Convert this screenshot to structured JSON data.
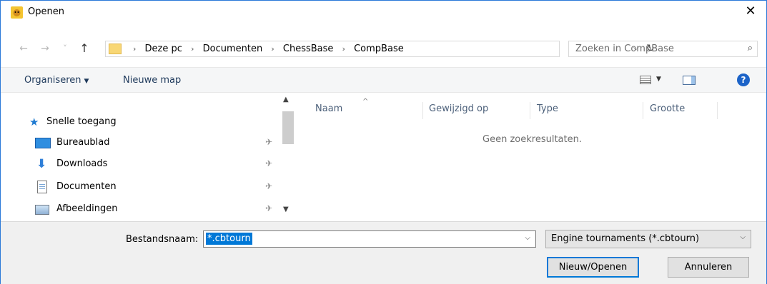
{
  "window": {
    "title": "Openen",
    "close_symbol": "✕"
  },
  "address": {
    "back_symbol": "←",
    "forward_symbol": "→",
    "recent_symbol": "˅",
    "up_symbol": "↑",
    "breadcrumbs": [
      "Deze pc",
      "Documenten",
      "ChessBase",
      "CompBase"
    ],
    "separator": "›",
    "dropdown_symbol": "⌵",
    "refresh_symbol": "↻"
  },
  "search": {
    "placeholder": "Zoeken in CompBase",
    "icon_symbol": "⌕"
  },
  "toolbar": {
    "organize_label": "Organiseren",
    "organize_caret": "▼",
    "new_folder_label": "Nieuwe map",
    "view_caret": "▼",
    "help_symbol": "?"
  },
  "navpane": {
    "quick_access": "Snelle toegang",
    "items": [
      {
        "label": "Bureaublad",
        "icon": "desktop-icon",
        "pinned": true
      },
      {
        "label": "Downloads",
        "icon": "download-icon",
        "pinned": true
      },
      {
        "label": "Documenten",
        "icon": "document-icon",
        "pinned": true
      },
      {
        "label": "Afbeeldingen",
        "icon": "pictures-icon",
        "pinned": true
      }
    ],
    "pin_symbol": "✈",
    "scroll_up": "▲",
    "scroll_down": "▼"
  },
  "filelist": {
    "columns": [
      "Naam",
      "Gewijzigd op",
      "Type",
      "Grootte"
    ],
    "sort_indicator": "^",
    "empty_message": "Geen zoekresultaten."
  },
  "bottom": {
    "filename_label": "Bestandsnaam:",
    "filename_value": "*.cbtourn",
    "combo_caret": "⌵",
    "filter_value": "Engine tournaments (*.cbtourn)",
    "open_button": "Nieuw/Openen",
    "cancel_button": "Annuleren"
  },
  "colors": {
    "accent": "#0078d7",
    "window_border": "#2b79d8",
    "folder": "#f8d775"
  }
}
